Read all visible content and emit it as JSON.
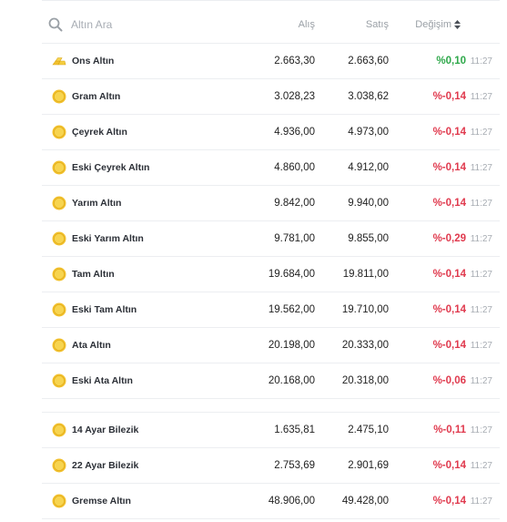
{
  "search": {
    "placeholder": "Altın Ara",
    "icon": "search-icon"
  },
  "columns": {
    "buy": "Alış",
    "sell": "Satış",
    "change": "Değişim"
  },
  "colors": {
    "negative": "#e03a4e",
    "positive": "#2ea84a",
    "coin_gold": "#f2c12e"
  },
  "rows": [
    {
      "name": "Ons Altın",
      "icon": "gold-bars-icon",
      "buy": "2.663,30",
      "sell": "2.663,60",
      "change": "%0,10",
      "trend": "pos",
      "time": "11:27"
    },
    {
      "name": "Gram Altın",
      "icon": "gold-coin-icon",
      "buy": "3.028,23",
      "sell": "3.038,62",
      "change": "%-0,14",
      "trend": "neg",
      "time": "11:27"
    },
    {
      "name": "Çeyrek Altın",
      "icon": "gold-coin-icon",
      "buy": "4.936,00",
      "sell": "4.973,00",
      "change": "%-0,14",
      "trend": "neg",
      "time": "11:27"
    },
    {
      "name": "Eski Çeyrek Altın",
      "icon": "gold-coin-icon",
      "buy": "4.860,00",
      "sell": "4.912,00",
      "change": "%-0,14",
      "trend": "neg",
      "time": "11:27"
    },
    {
      "name": "Yarım Altın",
      "icon": "gold-coin-icon",
      "buy": "9.842,00",
      "sell": "9.940,00",
      "change": "%-0,14",
      "trend": "neg",
      "time": "11:27"
    },
    {
      "name": "Eski Yarım Altın",
      "icon": "gold-coin-icon",
      "buy": "9.781,00",
      "sell": "9.855,00",
      "change": "%-0,29",
      "trend": "neg",
      "time": "11:27"
    },
    {
      "name": "Tam Altın",
      "icon": "gold-coin-icon",
      "buy": "19.684,00",
      "sell": "19.811,00",
      "change": "%-0,14",
      "trend": "neg",
      "time": "11:27"
    },
    {
      "name": "Eski Tam Altın",
      "icon": "gold-coin-icon",
      "buy": "19.562,00",
      "sell": "19.710,00",
      "change": "%-0,14",
      "trend": "neg",
      "time": "11:27"
    },
    {
      "name": "Ata Altın",
      "icon": "gold-coin-icon",
      "buy": "20.198,00",
      "sell": "20.333,00",
      "change": "%-0,14",
      "trend": "neg",
      "time": "11:27"
    },
    {
      "name": "Eski Ata Altın",
      "icon": "gold-coin-icon",
      "buy": "20.168,00",
      "sell": "20.318,00",
      "change": "%-0,06",
      "trend": "neg",
      "time": "11:27"
    }
  ],
  "rows2": [
    {
      "name": "14 Ayar Bilezik",
      "icon": "gold-coin-icon",
      "buy": "1.635,81",
      "sell": "2.475,10",
      "change": "%-0,11",
      "trend": "neg",
      "time": "11:27"
    },
    {
      "name": "22 Ayar Bilezik",
      "icon": "gold-coin-icon",
      "buy": "2.753,69",
      "sell": "2.901,69",
      "change": "%-0,14",
      "trend": "neg",
      "time": "11:27"
    },
    {
      "name": "Gremse Altın",
      "icon": "gold-coin-icon",
      "buy": "48.906,00",
      "sell": "49.428,00",
      "change": "%-0,14",
      "trend": "neg",
      "time": "11:27"
    }
  ]
}
